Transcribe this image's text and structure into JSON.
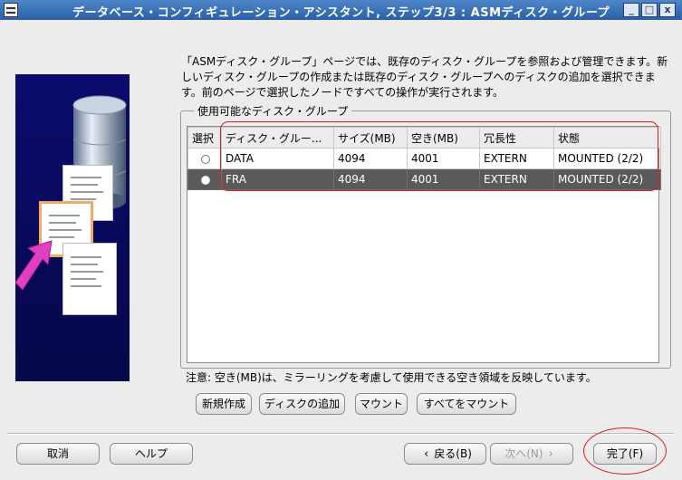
{
  "window": {
    "title": "データベース・コンフィギュレーション・アシスタント, ステップ3/3 : ASMディスク・グループ",
    "controls": {
      "minimize": "_",
      "maximize": "□",
      "close": "x"
    }
  },
  "description": "「ASMディスク・グループ」ページでは、既存のディスク・グループを参照および管理できます。新しいディスク・グループの作成または既存のディスク・グループへのディスクの追加を選択できます。前のページで選択したノードですべての操作が実行されます。",
  "group": {
    "legend": "使用可能なディスク・グループ",
    "columns": [
      "選択",
      "ディスク・グルー...",
      "サイズ(MB)",
      "空き(MB)",
      "冗長性",
      "状態"
    ],
    "rows": [
      {
        "name": "DATA",
        "size": "4094",
        "free": "4001",
        "redundancy": "EXTERN",
        "state": "MOUNTED (2/2)",
        "selected": false
      },
      {
        "name": "FRA",
        "size": "4094",
        "free": "4001",
        "redundancy": "EXTERN",
        "state": "MOUNTED (2/2)",
        "selected": true
      }
    ]
  },
  "note": "注意: 空き(MB)は、ミラーリングを考慮して使用できる空き領域を反映しています。",
  "actions": {
    "create": "新規作成",
    "add_disks": "ディスクの追加",
    "mount": "マウント",
    "mount_all": "すべてをマウント"
  },
  "nav": {
    "cancel": "取消",
    "help": "ヘルプ",
    "back": "戻る(B)",
    "next": "次へ(N)",
    "finish": "完了(F)"
  },
  "colors": {
    "titlebar": "#3a72b8",
    "selected_row": "#5a5a5a",
    "annotation_red": "#d42020",
    "illustration_bg": "#0b0b6e"
  }
}
